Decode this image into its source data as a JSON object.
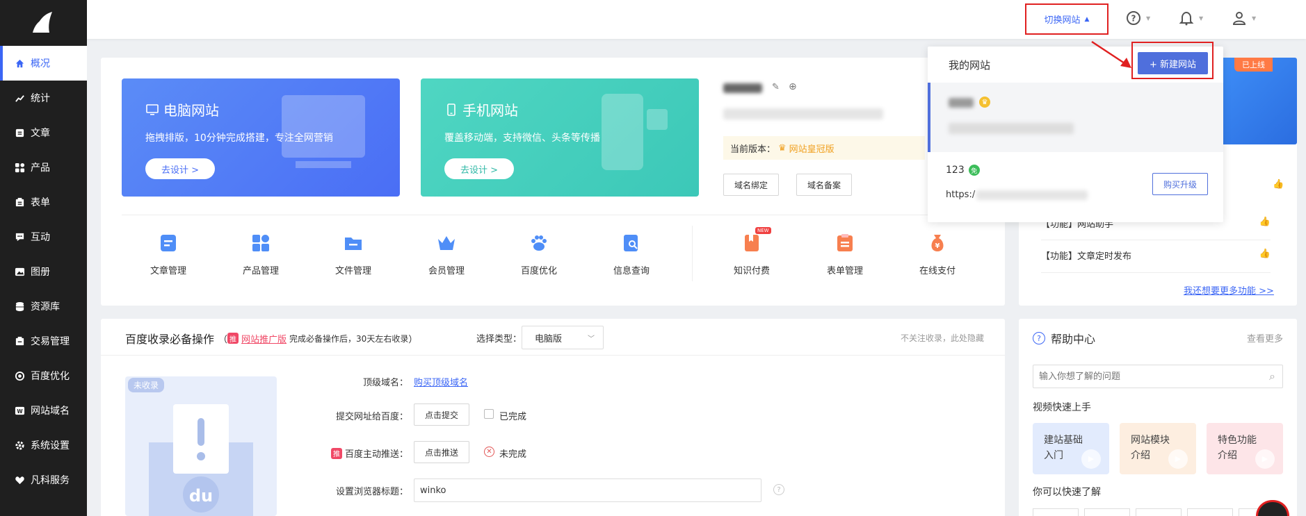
{
  "sidebar": {
    "items": [
      {
        "label": "概况",
        "icon": "home-icon"
      },
      {
        "label": "统计",
        "icon": "chart-icon"
      },
      {
        "label": "文章",
        "icon": "article-icon"
      },
      {
        "label": "产品",
        "icon": "grid-icon"
      },
      {
        "label": "表单",
        "icon": "form-icon"
      },
      {
        "label": "互动",
        "icon": "chat-icon"
      },
      {
        "label": "图册",
        "icon": "album-icon"
      },
      {
        "label": "资源库",
        "icon": "database-icon"
      },
      {
        "label": "交易管理",
        "icon": "trade-icon"
      },
      {
        "label": "百度优化",
        "icon": "seo-icon"
      },
      {
        "label": "网站域名",
        "icon": "domain-icon"
      },
      {
        "label": "系统设置",
        "icon": "gear-icon"
      },
      {
        "label": "凡科服务",
        "icon": "heart-icon"
      }
    ]
  },
  "topbar": {
    "switch_site": "切换网站"
  },
  "banners": {
    "pc": {
      "title": "电脑网站",
      "desc": "拖拽排版，10分钟完成搭建，专注全网营销",
      "btn": "去设计 >"
    },
    "mobile": {
      "title": "手机网站",
      "desc": "覆盖移动端，支持微信、头条等传播",
      "btn": "去设计 >"
    }
  },
  "site_info": {
    "version_label": "当前版本：",
    "version_value": "网站皇冠版",
    "bind_btn": "域名绑定",
    "record_btn": "域名备案"
  },
  "tools": [
    {
      "label": "文章管理"
    },
    {
      "label": "产品管理"
    },
    {
      "label": "文件管理"
    },
    {
      "label": "会员管理"
    },
    {
      "label": "百度优化"
    },
    {
      "label": "信息查询"
    },
    {
      "label": "知识付费",
      "badge": "NEW"
    },
    {
      "label": "表单管理"
    },
    {
      "label": "在线支付"
    }
  ],
  "dropdown": {
    "title": "我的网站",
    "new_site_btn": "+ 新建网站",
    "site2_name": "123",
    "site2_badge": "免",
    "site2_url": "https:/",
    "upgrade_btn": "购买升级",
    "online_tag": "已上线"
  },
  "functions": {
    "items": [
      "【功能】网站助手",
      "【功能】文章定时发布"
    ],
    "more": "我还想要更多功能 >>"
  },
  "baidu": {
    "title": "百度收录必备操作",
    "paren_open": "（",
    "promo_link": "网站推广版",
    "promo_desc": "完成必备操作后，30天左右收录",
    "paren_close": "）",
    "type_label": "选择类型：",
    "type_value": "电脑版",
    "hide_text": "不关注收录，此处隐藏",
    "status_tag": "未收录",
    "rows": {
      "domain_label": "顶级域名：",
      "domain_link": "购买顶级域名",
      "submit_label": "提交网址给百度：",
      "submit_btn": "点击提交",
      "submit_status": "已完成",
      "push_label": "百度主动推送：",
      "push_btn": "点击推送",
      "push_status": "未完成",
      "title_label": "设置浏览器标题：",
      "title_value": "winko"
    }
  },
  "help": {
    "title": "帮助中心",
    "more": "查看更多",
    "search_placeholder": "输入你想了解的问题",
    "video_title": "视频快速上手",
    "videos": [
      {
        "l1": "建站基础",
        "l2": "入门"
      },
      {
        "l1": "网站模块",
        "l2": "介绍"
      },
      {
        "l1": "特色功能",
        "l2": "介绍"
      }
    ],
    "learn_title": "你可以快速了解"
  },
  "colors": {
    "accent": "#3b66f5",
    "sidebar_bg": "#1f1f1f",
    "alert": "#e02020"
  }
}
